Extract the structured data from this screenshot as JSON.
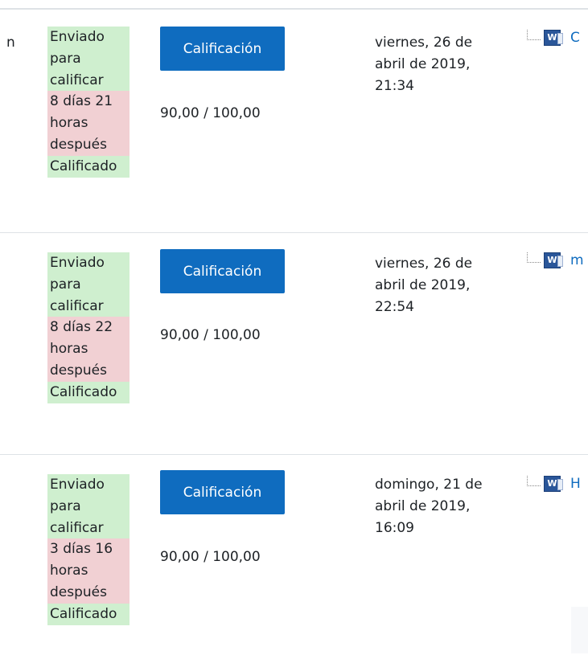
{
  "rows": [
    {
      "lead": "n",
      "status": [
        "Enviado para calificar",
        "8 días 21 horas después",
        "Calificado"
      ],
      "button": "Calificación",
      "grade": "90,00 / 100,00",
      "date": "viernes, 26 de abril de 2019, 21:34",
      "file_initial": "C",
      "file_icon": "word-document-icon"
    },
    {
      "lead": "",
      "status": [
        "Enviado para calificar",
        "8 días 22 horas después",
        "Calificado"
      ],
      "button": "Calificación",
      "grade": "90,00 / 100,00",
      "date": "viernes, 26 de abril de 2019, 22:54",
      "file_initial": "m",
      "file_icon": "word-document-icon"
    },
    {
      "lead": "",
      "status": [
        "Enviado para calificar",
        "3 días 16 horas después",
        "Calificado"
      ],
      "button": "Calificación",
      "grade": "90,00 / 100,00",
      "date": "domingo, 21 de abril de 2019, 16:09",
      "file_initial": "H",
      "file_icon": "word-document-icon"
    }
  ],
  "colors": {
    "button": "#0f6cbf",
    "status_green": "#cfefcf",
    "status_red": "#f1d0d3"
  }
}
